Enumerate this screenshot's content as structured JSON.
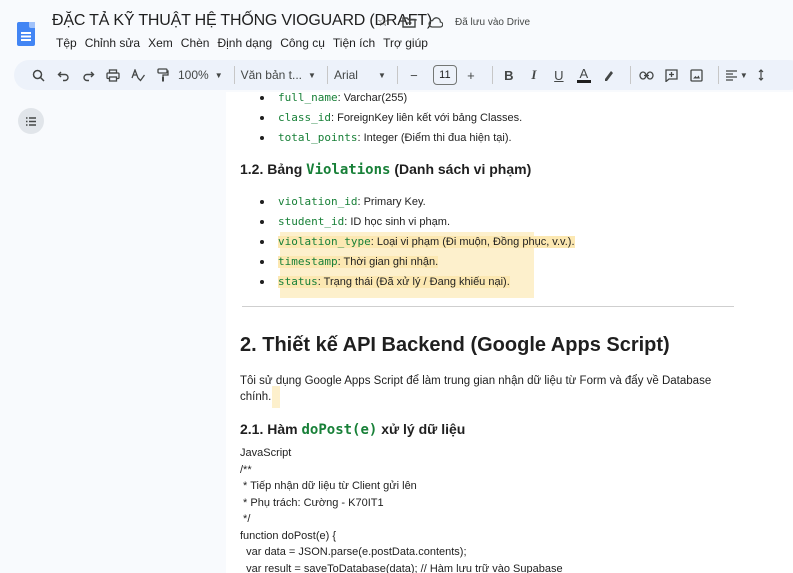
{
  "header": {
    "doc_title": "ĐẶC TẢ KỸ THUẬT HỆ THỐNG VIOGUARD (DRAFT)",
    "save_status": "Đã lưu vào Drive",
    "menu": [
      "Tệp",
      "Chỉnh sửa",
      "Xem",
      "Chèn",
      "Định dạng",
      "Công cụ",
      "Tiện ích",
      "Trợ giúp"
    ]
  },
  "toolbar": {
    "zoom": "100%",
    "style": "Văn bản t...",
    "font": "Arial",
    "font_size": "11",
    "minus": "−",
    "plus": "+",
    "bold": "B",
    "italic": "I",
    "underline": "U",
    "text_color": "A"
  },
  "doc": {
    "top_bullets": [
      {
        "code": "full_name",
        "text": ": Varchar(255)"
      },
      {
        "code": "class_id",
        "text": ": ForeignKey liên kết với bảng Classes."
      },
      {
        "code": "total_points",
        "text": ": Integer (Điểm thi đua hiện tại)."
      }
    ],
    "h3_violations": {
      "prefix": "1.2. Bảng ",
      "code": "Violations",
      "suffix": " (Danh sách vi phạm)"
    },
    "violation_bullets": [
      {
        "code": "violation_id",
        "text": ": Primary Key."
      },
      {
        "code": "student_id",
        "text": ": ID học sinh vi phạm."
      },
      {
        "code": "violation_type",
        "text": ": Loại vi phạm (Đi muộn, Đồng phục, v.v.)."
      },
      {
        "code": "timestamp",
        "text": ": Thời gian ghi nhận."
      },
      {
        "code": "status",
        "text": ": Trạng thái (Đã xử lý / Đang khiếu nại)."
      }
    ],
    "h2_api": "2. Thiết kế API Backend (Google Apps Script)",
    "para_api_line1": "Tôi sử dụng Google Apps Script để làm trung gian nhận dữ liệu từ Form và đẩy về Database",
    "para_api_line2": "chính.",
    "h3_dopost": {
      "prefix": "2.1. Hàm ",
      "code": "doPost(e)",
      "suffix": " xử lý dữ liệu"
    },
    "code_lines": [
      "JavaScript",
      "/**",
      " * Tiếp nhận dữ liệu từ Client gửi lên",
      " * Phụ trách: Cường - K70IT1",
      " */",
      "function doPost(e) {",
      "  var data = JSON.parse(e.postData.contents);",
      "  var result = saveToDatabase(data); // Hàm lưu trữ vào Supabase"
    ]
  },
  "colors": {
    "code_green": "#188038",
    "highlight": "#fce8b2",
    "accent_blue": "#4285f4"
  }
}
